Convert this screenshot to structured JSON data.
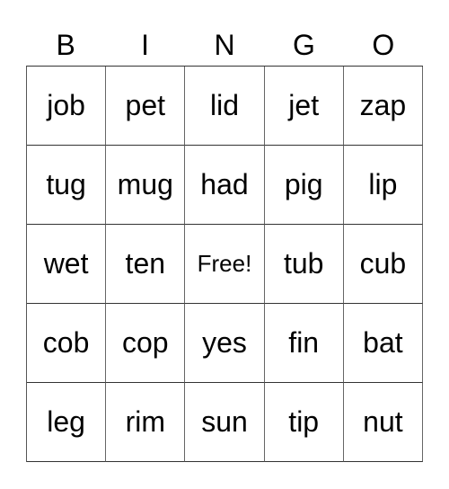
{
  "header": [
    "B",
    "I",
    "N",
    "G",
    "O"
  ],
  "rows": [
    [
      "job",
      "pet",
      "lid",
      "jet",
      "zap"
    ],
    [
      "tug",
      "mug",
      "had",
      "pig",
      "lip"
    ],
    [
      "wet",
      "ten",
      "Free!",
      "tub",
      "cub"
    ],
    [
      "cob",
      "cop",
      "yes",
      "fin",
      "bat"
    ],
    [
      "leg",
      "rim",
      "sun",
      "tip",
      "nut"
    ]
  ]
}
